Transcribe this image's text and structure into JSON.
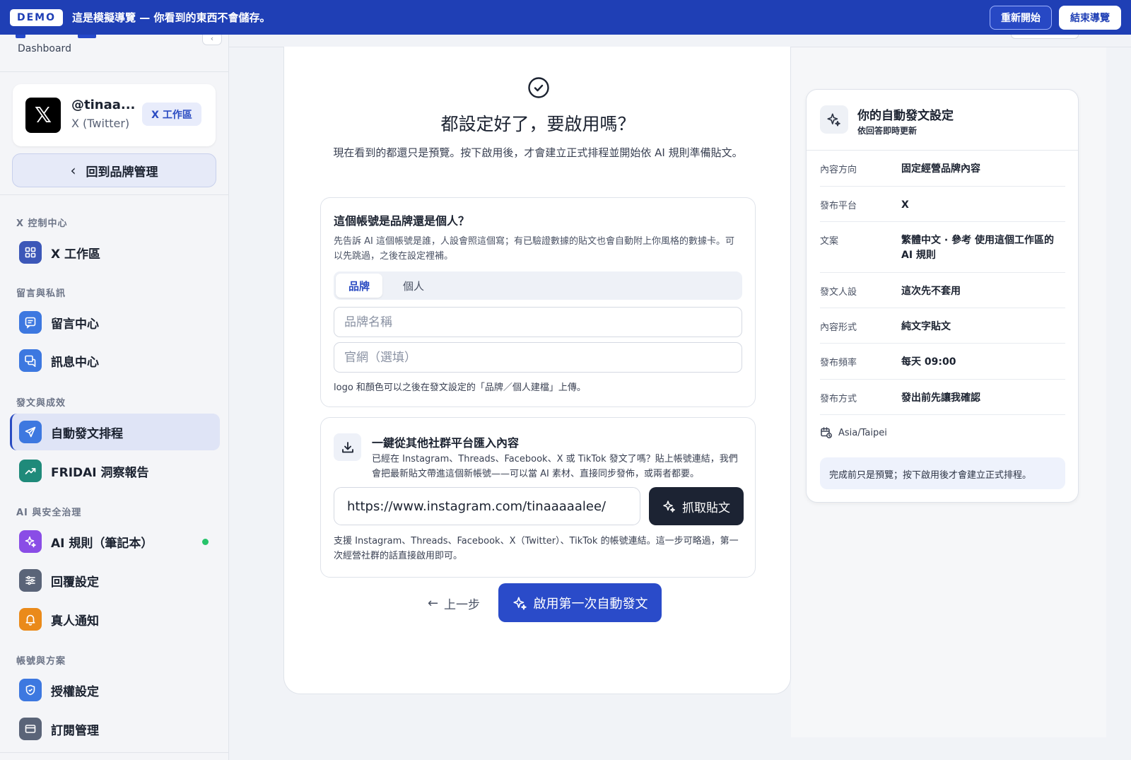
{
  "demo_bar": {
    "badge": "DEMO",
    "message": "這是模擬導覽 — 你看到的東西不會儲存。",
    "restart_label": "重新開始",
    "end_label": "結束導覽"
  },
  "sidebar": {
    "dashboard_label": "Dashboard",
    "account": {
      "logo": "𝕏",
      "handle": "@tinaa...",
      "platform": "X (Twitter)",
      "workspace_chip": "X 工作區"
    },
    "back_button": "回到品牌管理",
    "sections": [
      {
        "title": "X 控制中心",
        "items": [
          {
            "label": "X 工作區",
            "icon": "grid-icon"
          }
        ]
      },
      {
        "title": "留言與私訊",
        "items": [
          {
            "label": "留言中心",
            "icon": "comment-icon"
          },
          {
            "label": "訊息中心",
            "icon": "chat-icon"
          }
        ]
      },
      {
        "title": "發文與成效",
        "items": [
          {
            "label": "自動發文排程",
            "icon": "send-icon",
            "active": true
          },
          {
            "label": "FRIDAI 洞察報告",
            "icon": "trend-icon"
          }
        ]
      },
      {
        "title": "AI 與安全治理",
        "items": [
          {
            "label": "AI 規則（筆記本）",
            "icon": "sparkle-icon",
            "status": "active"
          },
          {
            "label": "回覆設定",
            "icon": "sliders-icon"
          },
          {
            "label": "真人通知",
            "icon": "bell-icon"
          }
        ]
      },
      {
        "title": "帳號與方案",
        "items": [
          {
            "label": "授權設定",
            "icon": "shield-icon"
          },
          {
            "label": "訂閱管理",
            "icon": "card-icon"
          }
        ]
      }
    ],
    "colors": {
      "accent": "#2a4bc2",
      "status_dot": "#27c36a"
    }
  },
  "wizard": {
    "title": "都設定好了，要啟用嗎？",
    "description": "現在看到的都還只是預覽。按下啟用後，才會建立正式排程並開始依 AI 規則準備貼文。",
    "brand_panel": {
      "title": "這個帳號是品牌還是個人？",
      "description": "先告訴 AI 這個帳號是誰，人設會照這個寫；有已驗證數據的貼文也會自動附上你風格的數據卡。可以先跳過，之後在設定裡補。",
      "segments": [
        "品牌",
        "個人"
      ],
      "selected_segment": "品牌",
      "brand_name_placeholder": "品牌名稱",
      "website_placeholder": "官網（選填）",
      "note": "logo 和顏色可以之後在發文設定的「品牌／個人建檔」上傳。"
    },
    "import_panel": {
      "title": "一鍵從其他社群平台匯入內容",
      "description": "已經在 Instagram、Threads、Facebook、X 或 TikTok 發文了嗎？貼上帳號連結，我們會把最新貼文帶進這個新帳號——可以當 AI 素材、直接同步發佈，或兩者都要。",
      "url_value": "https://www.instagram.com/tinaaaaalee/",
      "fetch_label": "抓取貼文",
      "note": "支援 Instagram、Threads、Facebook、X（Twitter）、TikTok 的帳號連結。這一步可略過，第一次經營社群的話直接啟用即可。"
    },
    "prev_label": "上一步",
    "launch_label": "啟用第一次自動發文"
  },
  "summary": {
    "title": "你的自動發文設定",
    "subtitle": "依回答即時更新",
    "rows": [
      {
        "key": "內容方向",
        "value": "固定經營品牌內容"
      },
      {
        "key": "發布平台",
        "value": "X"
      },
      {
        "key": "文案",
        "value": "繁體中文 · 參考 使用這個工作區的 AI 規則"
      },
      {
        "key": "發文人設",
        "value": "這次先不套用"
      },
      {
        "key": "內容形式",
        "value": "純文字貼文"
      },
      {
        "key": "發布頻率",
        "value": "每天 09:00"
      },
      {
        "key": "發布方式",
        "value": "發出前先讓我確認"
      }
    ],
    "timezone": "Asia/Taipei",
    "note": "完成前只是預覽；按下啟用後才會建立正式排程。"
  }
}
